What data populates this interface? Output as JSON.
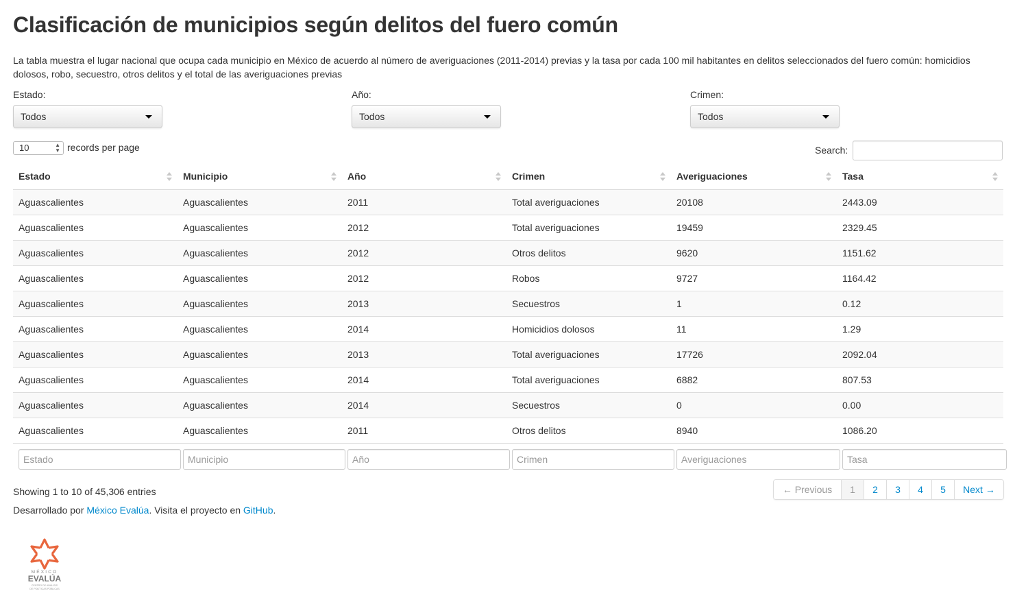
{
  "title": "Clasificación de municipios según delitos del fuero común",
  "description": "La tabla muestra el lugar nacional que ocupa cada municipio en México de acuerdo al número de averiguaciones (2011-2014) previas y la tasa por cada 100 mil habitantes en delitos seleccionados del fuero común: homicidios dolosos, robo, secuestro, otros delitos y el total de las averiguaciones previas",
  "filters": [
    {
      "label": "Estado:",
      "value": "Todos"
    },
    {
      "label": "Año:",
      "value": "Todos"
    },
    {
      "label": "Crimen:",
      "value": "Todos"
    }
  ],
  "length": {
    "value": "10",
    "label": "records per page"
  },
  "search": {
    "label": "Search:",
    "value": ""
  },
  "table": {
    "headers": [
      "Estado",
      "Municipio",
      "Año",
      "Crimen",
      "Averiguaciones",
      "Tasa"
    ],
    "rows": [
      [
        "Aguascalientes",
        "Aguascalientes",
        "2011",
        "Total averiguaciones",
        "20108",
        "2443.09"
      ],
      [
        "Aguascalientes",
        "Aguascalientes",
        "2012",
        "Total averiguaciones",
        "19459",
        "2329.45"
      ],
      [
        "Aguascalientes",
        "Aguascalientes",
        "2012",
        "Otros delitos",
        "9620",
        "1151.62"
      ],
      [
        "Aguascalientes",
        "Aguascalientes",
        "2012",
        "Robos",
        "9727",
        "1164.42"
      ],
      [
        "Aguascalientes",
        "Aguascalientes",
        "2013",
        "Secuestros",
        "1",
        "0.12"
      ],
      [
        "Aguascalientes",
        "Aguascalientes",
        "2014",
        "Homicidios dolosos",
        "11",
        "1.29"
      ],
      [
        "Aguascalientes",
        "Aguascalientes",
        "2013",
        "Total averiguaciones",
        "17726",
        "2092.04"
      ],
      [
        "Aguascalientes",
        "Aguascalientes",
        "2014",
        "Total averiguaciones",
        "6882",
        "807.53"
      ],
      [
        "Aguascalientes",
        "Aguascalientes",
        "2014",
        "Secuestros",
        "0",
        "0.00"
      ],
      [
        "Aguascalientes",
        "Aguascalientes",
        "2011",
        "Otros delitos",
        "8940",
        "1086.20"
      ]
    ],
    "footer_placeholders": [
      "Estado",
      "Municipio",
      "Año",
      "Crimen",
      "Averiguaciones",
      "Tasa"
    ]
  },
  "info": "Showing 1 to 10 of 45,306 entries",
  "pagination": {
    "previous": "← Previous",
    "pages": [
      "1",
      "2",
      "3",
      "4",
      "5"
    ],
    "active": "1",
    "next": "Next →"
  },
  "credits": {
    "prefix": "Desarrollado por ",
    "link1": "México Evalúa",
    "middle": ". Visita el proyecto en ",
    "link2": "GitHub",
    "suffix": "."
  },
  "logo": {
    "top_text": "MÉXICO",
    "main_text": "EVALÚA",
    "sub_text_1": "CENTRO DE ANÁLISIS",
    "sub_text_2": "DE POLÍTICAS PÚBLICAS",
    "color": "#e8663d"
  },
  "colors": {
    "link": "#0088cc",
    "logo_accent": "#e8663d"
  }
}
